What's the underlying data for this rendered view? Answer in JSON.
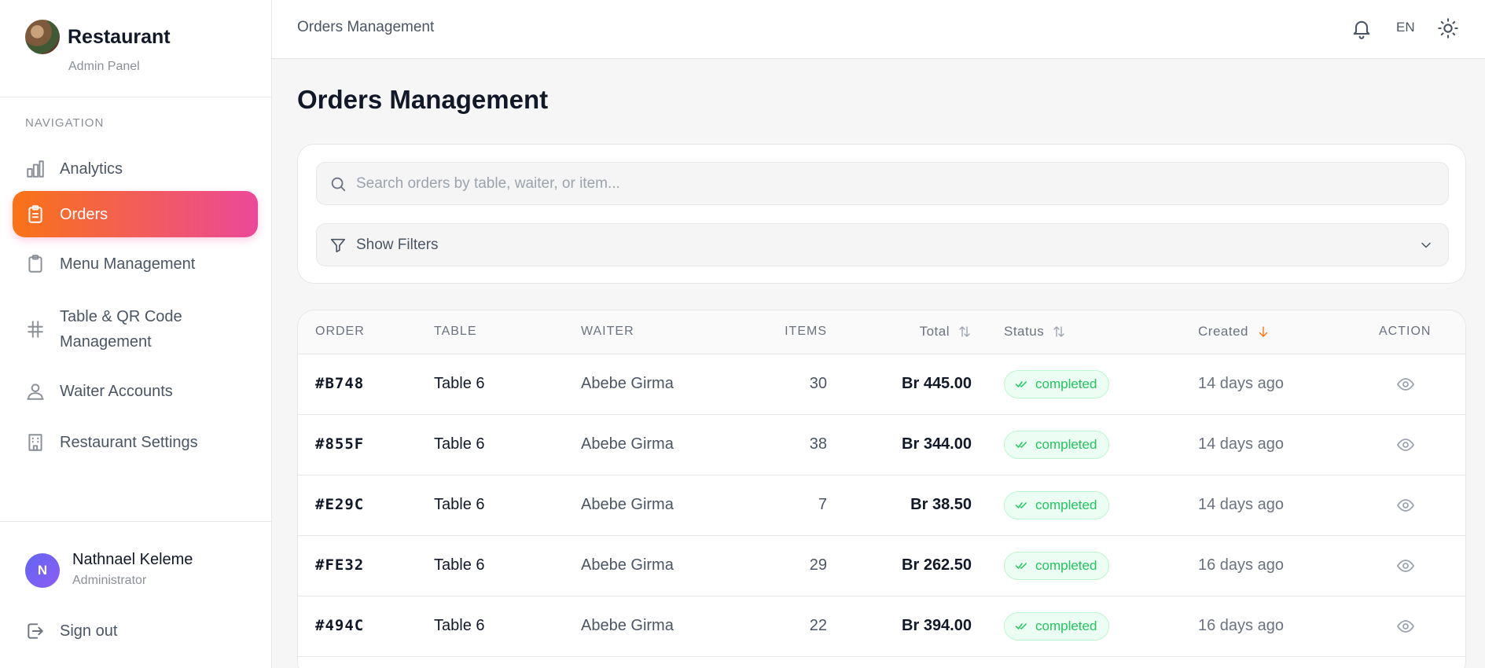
{
  "brand": {
    "name": "Restaurant",
    "subtitle": "Admin Panel"
  },
  "nav": {
    "heading": "NAVIGATION",
    "items": [
      {
        "label": "Analytics",
        "icon": "bar-chart-icon",
        "active": false
      },
      {
        "label": "Orders",
        "icon": "clipboard-list-icon",
        "active": true
      },
      {
        "label": "Menu Management",
        "icon": "clipboard-icon",
        "active": false
      },
      {
        "label": "Table & QR Code Management",
        "icon": "hash-icon",
        "active": false
      },
      {
        "label": "Waiter Accounts",
        "icon": "user-icon",
        "active": false
      },
      {
        "label": "Restaurant Settings",
        "icon": "building-icon",
        "active": false
      }
    ]
  },
  "user": {
    "initial": "N",
    "name": "Nathnael Keleme",
    "role": "Administrator",
    "signout": "Sign out"
  },
  "header": {
    "title": "Orders Management",
    "language": "EN"
  },
  "page": {
    "title": "Orders Management"
  },
  "search": {
    "placeholder": "Search orders by table, waiter, or item...",
    "value": ""
  },
  "filters": {
    "label": "Show Filters"
  },
  "table": {
    "columns": {
      "order": "ORDER",
      "table": "TABLE",
      "waiter": "WAITER",
      "items": "ITEMS",
      "total": "Total",
      "status": "Status",
      "created": "Created",
      "action": "ACTION"
    },
    "rows": [
      {
        "order": "#B748",
        "table": "Table 6",
        "waiter": "Abebe Girma",
        "items": "30",
        "total": "Br 445.00",
        "status": "completed",
        "created": "14 days ago"
      },
      {
        "order": "#855F",
        "table": "Table 6",
        "waiter": "Abebe Girma",
        "items": "38",
        "total": "Br 344.00",
        "status": "completed",
        "created": "14 days ago"
      },
      {
        "order": "#E29C",
        "table": "Table 6",
        "waiter": "Abebe Girma",
        "items": "7",
        "total": "Br 38.50",
        "status": "completed",
        "created": "14 days ago"
      },
      {
        "order": "#FE32",
        "table": "Table 6",
        "waiter": "Abebe Girma",
        "items": "29",
        "total": "Br 262.50",
        "status": "completed",
        "created": "16 days ago"
      },
      {
        "order": "#494C",
        "table": "Table 6",
        "waiter": "Abebe Girma",
        "items": "22",
        "total": "Br 394.00",
        "status": "completed",
        "created": "16 days ago"
      }
    ]
  },
  "colors": {
    "accent_start": "#f97316",
    "accent_end": "#ec4899",
    "status_completed": "#22c55e",
    "sort_active": "#f97316"
  }
}
